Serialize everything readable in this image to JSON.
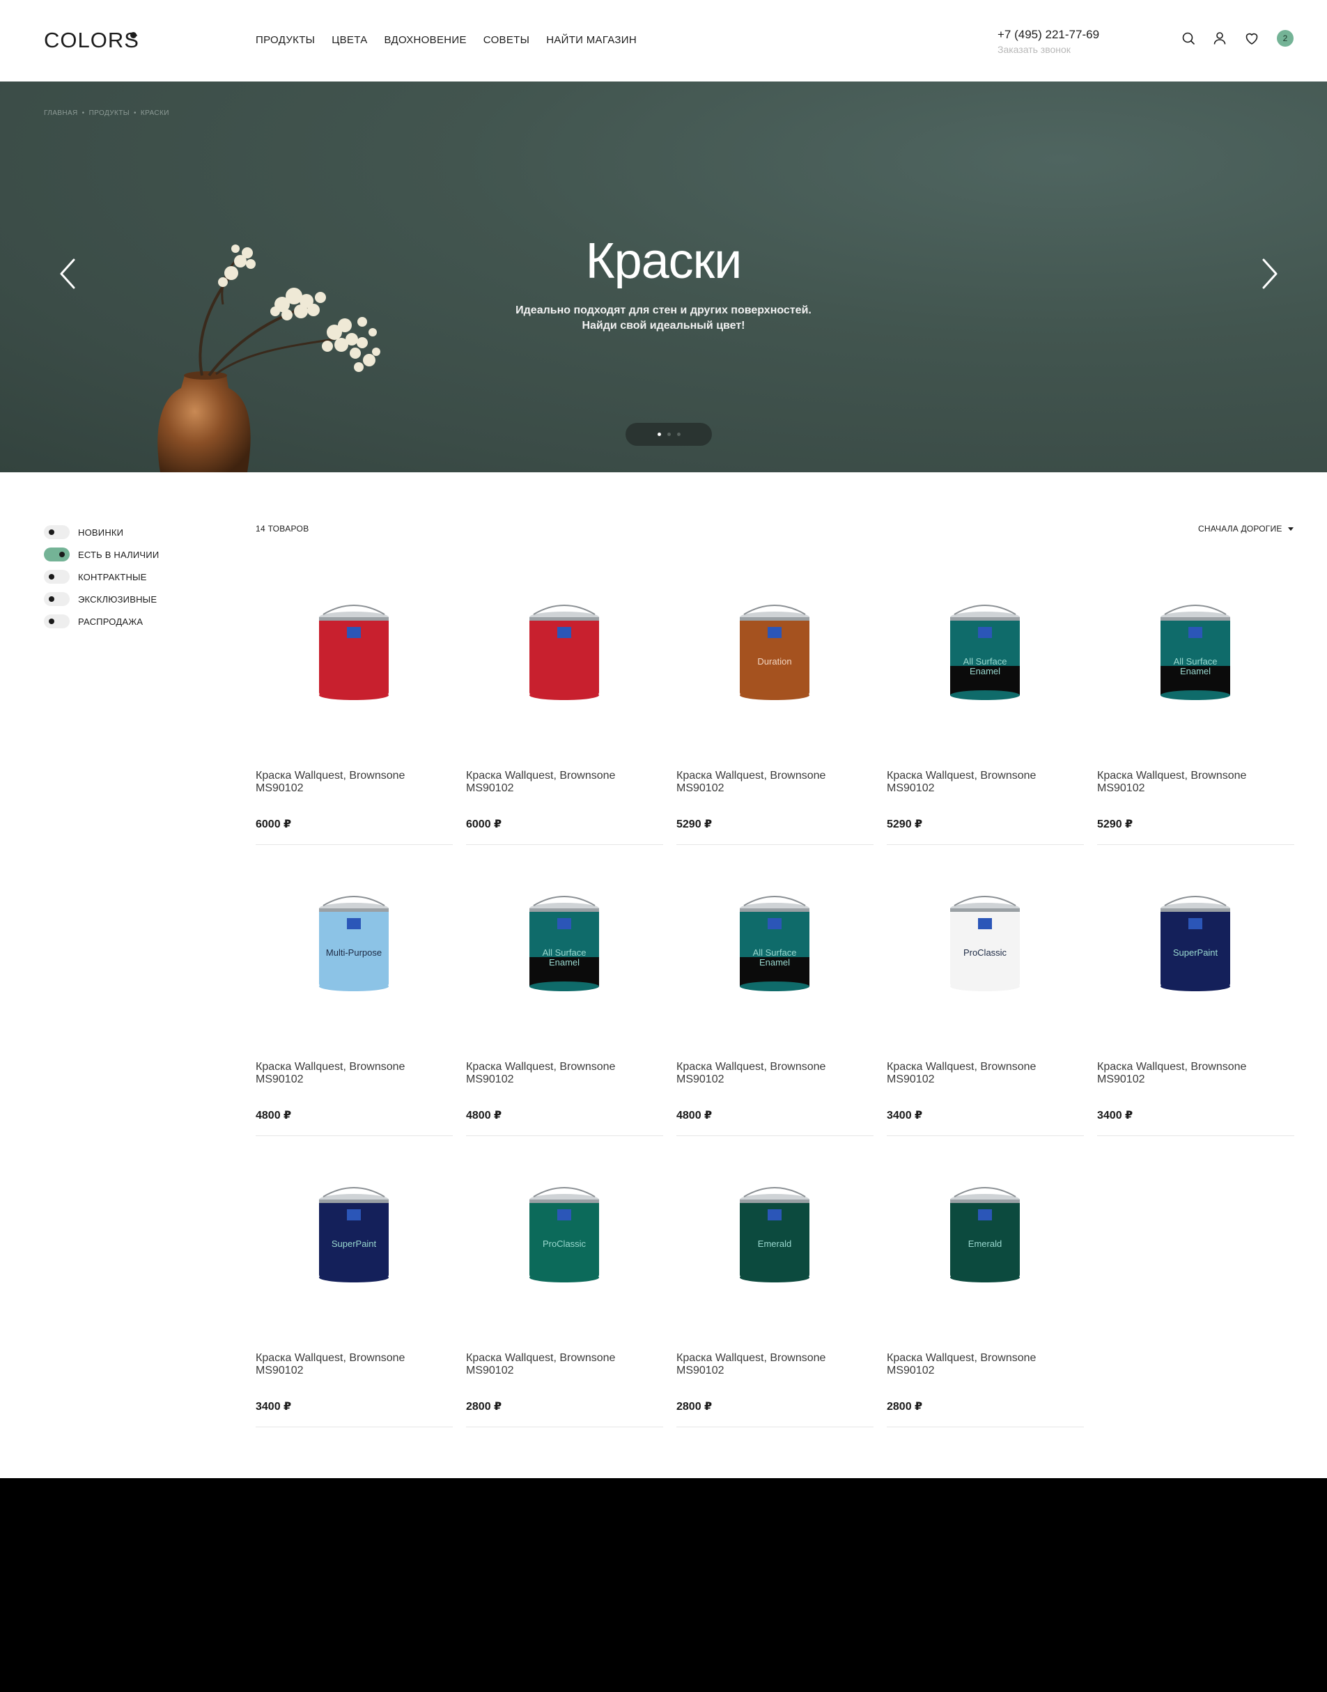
{
  "header": {
    "logo": "COLORS",
    "nav": [
      "ПРОДУКТЫ",
      "ЦВЕТА",
      "ВДОХНОВЕНИЕ",
      "СОВЕТЫ",
      "НАЙТИ МАГАЗИН"
    ],
    "phone": "+7 (495) 221-77-69",
    "callback": "Заказать звонок",
    "cart_count": "2",
    "icons": [
      "search-icon",
      "user-icon",
      "heart-icon",
      "cart-badge"
    ]
  },
  "hero": {
    "breadcrumbs": [
      "ГЛАВНАЯ",
      "•",
      "ПРОДУКТЫ",
      "•",
      "КРАСКИ"
    ],
    "title": "Краски",
    "subtitle_line1": "Идеально подходят для стен и других поверхностей.",
    "subtitle_line2": "Найди свой идеальный цвет!",
    "slides": 3,
    "active_slide": 1
  },
  "filters": [
    {
      "label": "НОВИНКИ",
      "on": false
    },
    {
      "label": "ЕСТЬ В НАЛИЧИИ",
      "on": true
    },
    {
      "label": "КОНТРАКТНЫЕ",
      "on": false
    },
    {
      "label": "ЭКСКЛЮЗИВНЫЕ",
      "on": false
    },
    {
      "label": "РАСПРОДАЖА",
      "on": false
    }
  ],
  "catalog": {
    "count": "14 ТОВАРОВ",
    "sort": "СНАЧАЛА ДОРОГИЕ"
  },
  "products": [
    {
      "name": "Краска Wallquest, Brownsone MS90102",
      "price": "6000 ₽",
      "can": "#c8202e",
      "label": ""
    },
    {
      "name": "Краска Wallquest, Brownsone MS90102",
      "price": "6000 ₽",
      "can": "#c8202e",
      "label": ""
    },
    {
      "name": "Краска Wallquest, Brownsone MS90102",
      "price": "5290 ₽",
      "can": "#a5521f",
      "label": "Duration"
    },
    {
      "name": "Краска Wallquest, Brownsone MS90102",
      "price": "5290 ₽",
      "can": "#0f6b6a",
      "label": "All Surface Enamel"
    },
    {
      "name": "Краска Wallquest, Brownsone MS90102",
      "price": "5290 ₽",
      "can": "#0f6b6a",
      "label": "All Surface Enamel"
    },
    {
      "name": "Краска Wallquest, Brownsone MS90102",
      "price": "4800 ₽",
      "can": "#8cc3e6",
      "label": "Multi-Purpose"
    },
    {
      "name": "Краска Wallquest, Brownsone MS90102",
      "price": "4800 ₽",
      "can": "#0f6b6a",
      "label": "All Surface Enamel"
    },
    {
      "name": "Краска Wallquest, Brownsone MS90102",
      "price": "4800 ₽",
      "can": "#0f6b6a",
      "label": "All Surface Enamel"
    },
    {
      "name": "Краска Wallquest, Brownsone MS90102",
      "price": "3400 ₽",
      "can": "#f4f4f4",
      "label": "ProClassic"
    },
    {
      "name": "Краска Wallquest, Brownsone MS90102",
      "price": "3400 ₽",
      "can": "#14205a",
      "label": "SuperPaint"
    },
    {
      "name": "Краска Wallquest, Brownsone MS90102",
      "price": "3400 ₽",
      "can": "#14205a",
      "label": "SuperPaint"
    },
    {
      "name": "Краска Wallquest, Brownsone MS90102",
      "price": "2800 ₽",
      "can": "#0c6a5a",
      "label": "ProClassic"
    },
    {
      "name": "Краска Wallquest, Brownsone MS90102",
      "price": "2800 ₽",
      "can": "#0c4a3e",
      "label": "Emerald"
    },
    {
      "name": "Краска Wallquest, Brownsone MS90102",
      "price": "2800 ₽",
      "can": "#0c4a3e",
      "label": "Emerald"
    }
  ],
  "colors": {
    "accent": "#74b396",
    "hero_bg": "#42554f",
    "footer_bg": "#000000"
  }
}
